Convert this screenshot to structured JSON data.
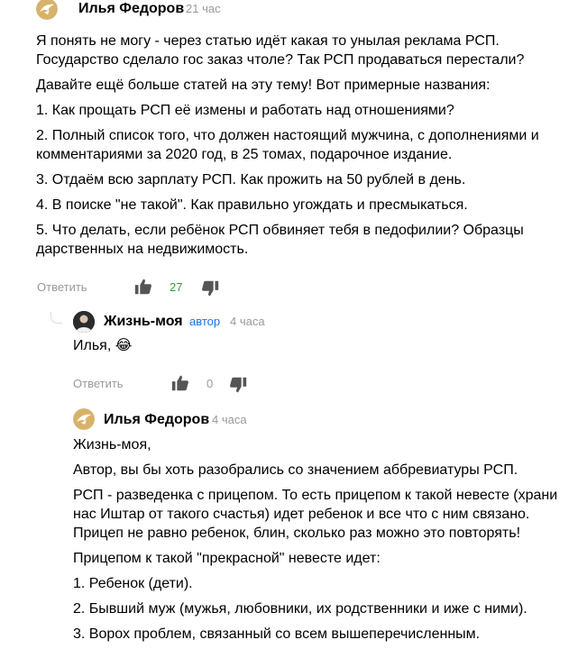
{
  "comments": [
    {
      "author": "Илья Федоров",
      "time": "21 час",
      "paragraphs": [
        "Я понять не могу - через статью идёт какая то унылая реклама РСП.\nГосударство сделало гос заказ чтоле? Так РСП продаваться перестали?",
        "Давайте ещё больше статей на эту тему! Вот примерные названия:",
        "1. Как прощать РСП её измены и работать над отношениями?",
        "2. Полный список того, что должен настоящий мужчина, с дополнениями и\nкомментариями за 2020 год, в 25 томах, подарочное издание.",
        "3. Отдаём всю зарплату РСП. Как прожить на 50 рублей в день.",
        "4. В поиске \"не такой\". Как правильно угождать и пресмыкаться.",
        "5. Что делать, если ребёнок РСП обвиняет тебя в педофилии? Образцы\nдарственных на недвижимость."
      ],
      "reply_label": "Ответить",
      "likes": "27"
    },
    {
      "author": "Жизнь-моя",
      "badge": "автор",
      "time": "4 часа",
      "paragraphs": [
        "Илья, 😂"
      ],
      "reply_label": "Ответить",
      "likes": "0"
    },
    {
      "author": "Илья Федоров",
      "time": "4 часа",
      "paragraphs": [
        "Жизнь-моя,",
        "Автор, вы бы хоть разобрались со значением аббревиатуры РСП.",
        "РСП - разведенка с прицепом. То есть прицепом к такой невесте (храни\nнас Иштар от такого счастья) идет ребенок и все что с ним связано.\nПрицеп не равно ребенок, блин, сколько раз можно это повторять!",
        "Прицепом к такой \"прекрасной\" невесте идет:",
        "1. Ребенок (дети).",
        "2. Бывший муж (мужья, любовники, их родственники и иже с ними).",
        "3. Ворох проблем, связанный со всем вышеперечисленным."
      ]
    }
  ],
  "colors": {
    "likes_positive": "#2e9e3e",
    "meta": "#999999",
    "author_badge": "#1a73e8"
  }
}
